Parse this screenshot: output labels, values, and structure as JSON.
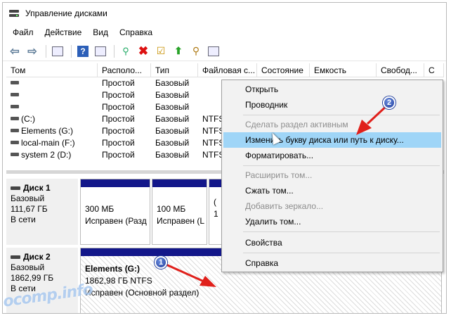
{
  "window": {
    "title": "Управление дисками"
  },
  "menu": [
    "Файл",
    "Действие",
    "Вид",
    "Справка"
  ],
  "toolbar": {
    "icons": [
      "back-arrow-icon",
      "forward-arrow-icon",
      "panel-icon",
      "help-icon",
      "properties-icon",
      "connect-icon",
      "delete-icon",
      "check-icon",
      "up-arrow-icon",
      "search-icon",
      "view-icon"
    ]
  },
  "volumes": {
    "columns": [
      "Том",
      "Располо...",
      "Тип",
      "Файловая с...",
      "Состояние",
      "Емкость",
      "Свобод...",
      "С"
    ],
    "rows": [
      {
        "name": "",
        "layout": "Простой",
        "type": "Базовый",
        "fs": ""
      },
      {
        "name": "",
        "layout": "Простой",
        "type": "Базовый",
        "fs": ""
      },
      {
        "name": "",
        "layout": "Простой",
        "type": "Базовый",
        "fs": ""
      },
      {
        "name": "(C:)",
        "layout": "Простой",
        "type": "Базовый",
        "fs": "NTFS"
      },
      {
        "name": "Elements (G:)",
        "layout": "Простой",
        "type": "Базовый",
        "fs": "NTFS"
      },
      {
        "name": "local-main (F:)",
        "layout": "Простой",
        "type": "Базовый",
        "fs": "NTFS"
      },
      {
        "name": "system 2 (D:)",
        "layout": "Простой",
        "type": "Базовый",
        "fs": "NTFS"
      }
    ]
  },
  "disks": [
    {
      "name": "Диск 1",
      "kind": "Базовый",
      "size": "111,67 ГБ",
      "status": "В сети",
      "partitions": [
        {
          "line1": "300 МБ",
          "line2": "Исправен (Разд"
        },
        {
          "line1": "100 МБ",
          "line2": "Исправен (L"
        },
        {
          "line1": "(",
          "line2": "1"
        }
      ]
    },
    {
      "name": "Диск 2",
      "kind": "Базовый",
      "size": "1862,99 ГБ",
      "status": "В сети",
      "partitions": [
        {
          "line1": "Elements  (G:)",
          "line2": "1862,98 ГБ NTFS",
          "line3": "Исправен (Основной раздел)"
        }
      ]
    }
  ],
  "context_menu": {
    "items": [
      {
        "label": "Открыть",
        "disabled": false
      },
      {
        "label": "Проводник",
        "disabled": false
      },
      {
        "label": "Сделать раздел активным",
        "disabled": true
      },
      {
        "label": "Изменить букву диска или путь к диску...",
        "disabled": false,
        "highlighted": true
      },
      {
        "label": "Форматировать...",
        "disabled": false
      },
      {
        "label": "Расширить том...",
        "disabled": true
      },
      {
        "label": "Сжать том...",
        "disabled": false
      },
      {
        "label": "Добавить зеркало...",
        "disabled": true
      },
      {
        "label": "Удалить том...",
        "disabled": false
      },
      {
        "label": "Свойства",
        "disabled": false
      },
      {
        "label": "Справка",
        "disabled": false
      }
    ]
  },
  "annotations": {
    "marker1": "1",
    "marker2": "2"
  },
  "watermark": "ocomp.info",
  "colors": {
    "partition_band": "#13178a",
    "highlight": "#9fd5f7",
    "annotation_arrow": "#e0201b"
  }
}
